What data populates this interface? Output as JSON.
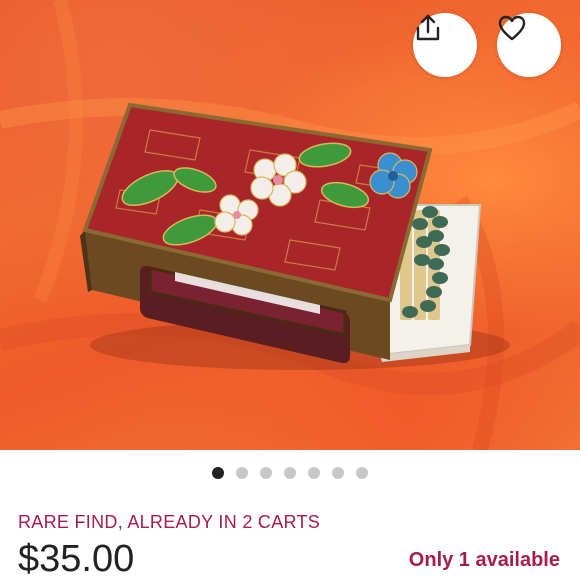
{
  "listing": {
    "image_alt": "Cloisonné matchbox holder with matches on orange cloth",
    "gallery": {
      "count": 7,
      "active_index": 0
    },
    "scarcity_banner": "RARE FIND, ALREADY IN 2 CARTS",
    "price": "$35.00",
    "availability": "Only 1 available"
  },
  "actions": {
    "share_icon": "share-icon",
    "favorite_icon": "heart-icon"
  },
  "colors": {
    "accent": "#a61d4d",
    "price": "#222222",
    "dot_active": "#222222",
    "dot_inactive": "#c8c8c8"
  }
}
